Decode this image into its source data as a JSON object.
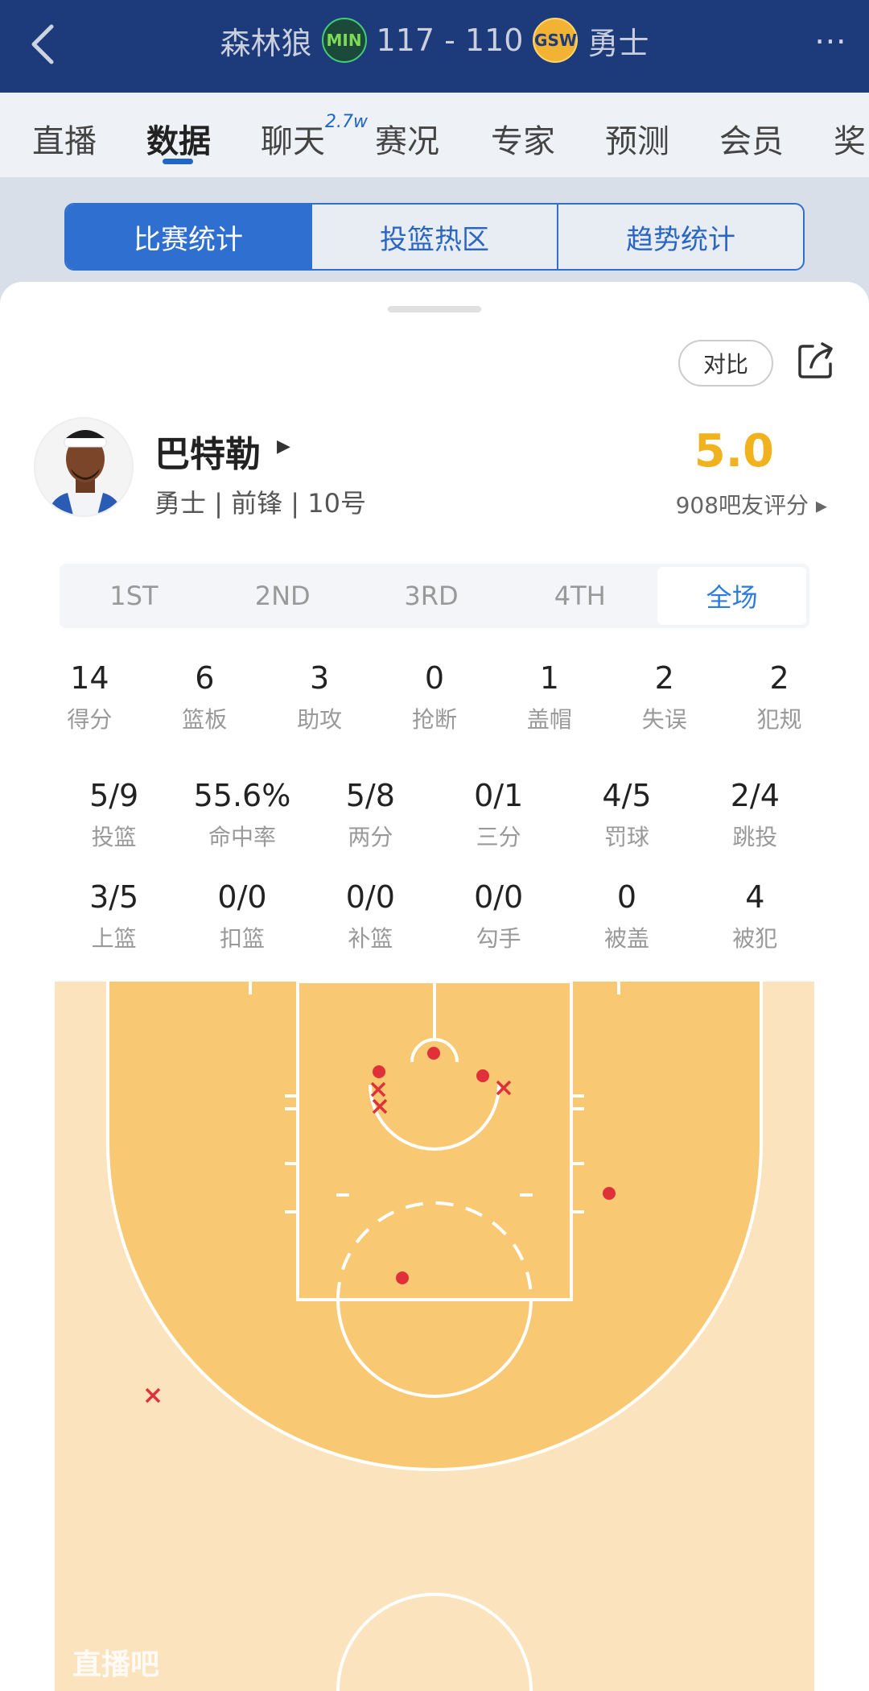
{
  "header": {
    "home_team": "森林狼",
    "home_logo": "MIN",
    "score": "117 - 110",
    "away_logo": "GSW",
    "away_team": "勇士",
    "more_icon": "⋯"
  },
  "nav_tabs": [
    "直播",
    "数据",
    "聊天",
    "赛况",
    "专家",
    "预测",
    "会员",
    "奖"
  ],
  "chat_badge": "2.7w",
  "segments": [
    "比赛统计",
    "投篮热区",
    "趋势统计"
  ],
  "compare_label": "对比",
  "player": {
    "name": "巴特勒",
    "meta": "勇士 | 前锋 | 10号",
    "rating": "5.0",
    "raters": "908吧友评分"
  },
  "quarters": [
    "1ST",
    "2ND",
    "3RD",
    "4TH",
    "全场"
  ],
  "stats_basic": [
    {
      "value": "14",
      "label": "得分"
    },
    {
      "value": "6",
      "label": "篮板"
    },
    {
      "value": "3",
      "label": "助攻"
    },
    {
      "value": "0",
      "label": "抢断"
    },
    {
      "value": "1",
      "label": "盖帽"
    },
    {
      "value": "2",
      "label": "失误"
    },
    {
      "value": "2",
      "label": "犯规"
    }
  ],
  "stats_shooting": [
    {
      "value": "5/9",
      "label": "投篮"
    },
    {
      "value": "55.6%",
      "label": "命中率"
    },
    {
      "value": "5/8",
      "label": "两分"
    },
    {
      "value": "0/1",
      "label": "三分"
    },
    {
      "value": "4/5",
      "label": "罚球"
    },
    {
      "value": "2/4",
      "label": "跳投"
    }
  ],
  "stats_detail": [
    {
      "value": "3/5",
      "label": "上篮"
    },
    {
      "value": "0/0",
      "label": "扣篮"
    },
    {
      "value": "0/0",
      "label": "补篮"
    },
    {
      "value": "0/0",
      "label": "勾手"
    },
    {
      "value": "0",
      "label": "被盖"
    },
    {
      "value": "4",
      "label": "被犯"
    }
  ],
  "watermark": "直播吧",
  "colors": {
    "accent": "#2f6fcf",
    "rating": "#f0b21d",
    "made": "#e0303a",
    "court_paint": "#f8c873",
    "court_outer": "#fbe3bd"
  }
}
